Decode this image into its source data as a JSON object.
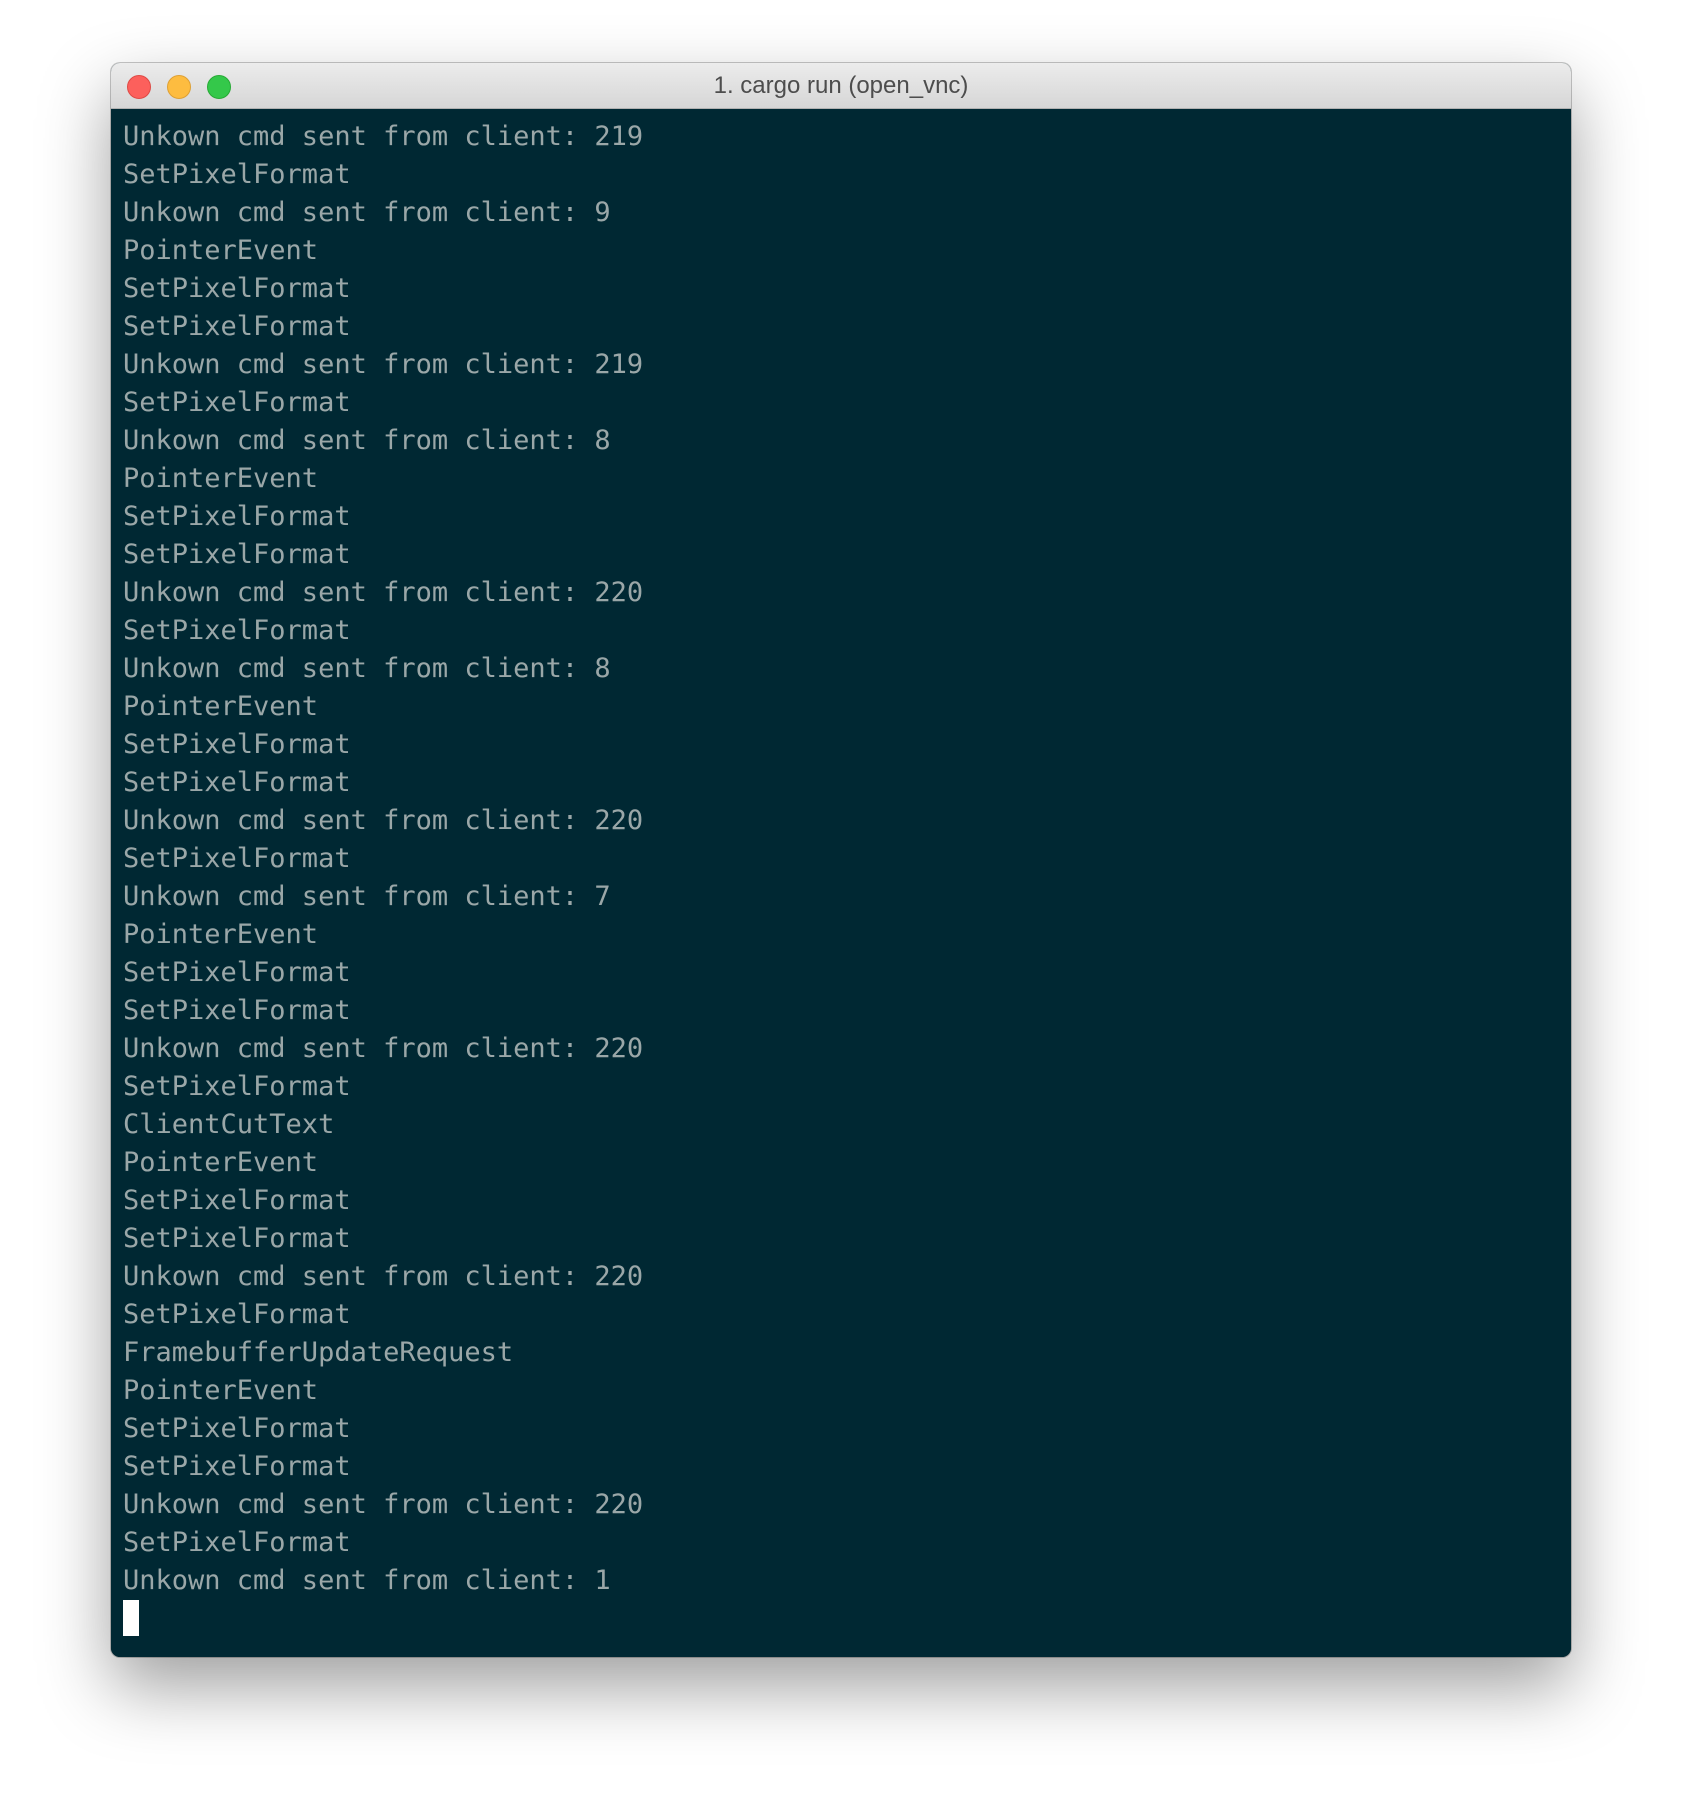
{
  "window": {
    "title": "1. cargo run (open_vnc)"
  },
  "terminal": {
    "lines": [
      "Unkown cmd sent from client: 219",
      "SetPixelFormat",
      "Unkown cmd sent from client: 9",
      "PointerEvent",
      "SetPixelFormat",
      "SetPixelFormat",
      "Unkown cmd sent from client: 219",
      "SetPixelFormat",
      "Unkown cmd sent from client: 8",
      "PointerEvent",
      "SetPixelFormat",
      "SetPixelFormat",
      "Unkown cmd sent from client: 220",
      "SetPixelFormat",
      "Unkown cmd sent from client: 8",
      "PointerEvent",
      "SetPixelFormat",
      "SetPixelFormat",
      "Unkown cmd sent from client: 220",
      "SetPixelFormat",
      "Unkown cmd sent from client: 7",
      "PointerEvent",
      "SetPixelFormat",
      "SetPixelFormat",
      "Unkown cmd sent from client: 220",
      "SetPixelFormat",
      "ClientCutText",
      "PointerEvent",
      "SetPixelFormat",
      "SetPixelFormat",
      "Unkown cmd sent from client: 220",
      "SetPixelFormat",
      "FramebufferUpdateRequest",
      "PointerEvent",
      "SetPixelFormat",
      "SetPixelFormat",
      "Unkown cmd sent from client: 220",
      "SetPixelFormat",
      "Unkown cmd sent from client: 1"
    ]
  },
  "colors": {
    "terminal_background": "#002833",
    "terminal_text": "#9aa7a8",
    "cursor": "#ffffff",
    "close_button": "#fc605c",
    "minimize_button": "#fdbc40",
    "zoom_button": "#34c84a"
  }
}
